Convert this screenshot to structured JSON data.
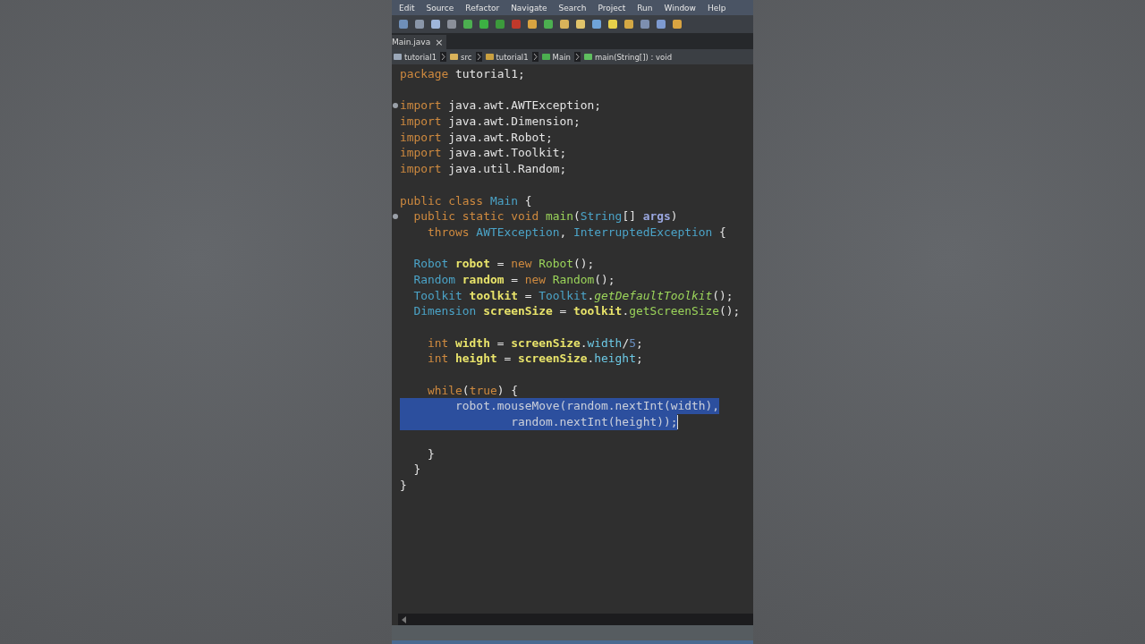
{
  "menu_bar": [
    "Edit",
    "Source",
    "Refactor",
    "Navigate",
    "Search",
    "Project",
    "Run",
    "Window",
    "Help"
  ],
  "editor_tab": {
    "label": "Main.java",
    "close": "×",
    "selected": true
  },
  "breadcrumb": [
    {
      "kind": "project",
      "label": "tutorial1"
    },
    {
      "kind": "folder",
      "label": "src"
    },
    {
      "kind": "package",
      "label": "tutorial1"
    },
    {
      "kind": "class",
      "label": "Main"
    },
    {
      "kind": "method",
      "label": "main(String[]) : void"
    }
  ],
  "code_lines": [
    {
      "selected": false,
      "tokens": [
        {
          "kind": "keyword",
          "text": "package"
        },
        {
          "kind": "plain",
          "text": " tutorial1;"
        }
      ]
    },
    {
      "selected": false
    },
    {
      "selected": false,
      "fold_marker": true,
      "tokens": [
        {
          "kind": "keyword",
          "text": "import"
        },
        {
          "kind": "plain",
          "text": " java.awt.AWTException;"
        }
      ]
    },
    {
      "selected": false,
      "tokens": [
        {
          "kind": "keyword",
          "text": "import"
        },
        {
          "kind": "plain",
          "text": " java.awt.Dimension;"
        }
      ]
    },
    {
      "selected": false,
      "tokens": [
        {
          "kind": "keyword",
          "text": "import"
        },
        {
          "kind": "plain",
          "text": " java.awt.Robot;"
        }
      ]
    },
    {
      "selected": false,
      "tokens": [
        {
          "kind": "keyword",
          "text": "import"
        },
        {
          "kind": "plain",
          "text": " java.awt.Toolkit;"
        }
      ]
    },
    {
      "selected": false,
      "tokens": [
        {
          "kind": "keyword",
          "text": "import"
        },
        {
          "kind": "plain",
          "text": " java.util.Random;"
        }
      ]
    },
    {
      "selected": false
    },
    {
      "selected": false,
      "tokens": [
        {
          "kind": "keyword",
          "text": "public class"
        },
        {
          "kind": "type",
          "text": " Main"
        },
        {
          "kind": "plain",
          "text": " {"
        }
      ]
    },
    {
      "selected": false,
      "fold_marker": true,
      "tokens": [
        {
          "kind": "keyword",
          "text": "  public static void"
        },
        {
          "kind": "method",
          "text": " main"
        },
        {
          "kind": "plain",
          "text": "("
        },
        {
          "kind": "type",
          "text": "String"
        },
        {
          "kind": "plain",
          "text": "[]"
        },
        {
          "kind": "param",
          "text": " args"
        },
        {
          "kind": "plain",
          "text": ")"
        }
      ]
    },
    {
      "selected": false,
      "tokens": [
        {
          "kind": "keyword",
          "text": "    throws"
        },
        {
          "kind": "type",
          "text": " AWTException"
        },
        {
          "kind": "plain",
          "text": ", "
        },
        {
          "kind": "type",
          "text": "InterruptedException"
        },
        {
          "kind": "plain",
          "text": " {"
        }
      ]
    },
    {
      "selected": false
    },
    {
      "selected": false,
      "tokens": [
        {
          "kind": "type",
          "text": "  Robot"
        },
        {
          "kind": "variable",
          "text": " robot"
        },
        {
          "kind": "plain",
          "text": " = "
        },
        {
          "kind": "keyword",
          "text": "new"
        },
        {
          "kind": "method",
          "text": " Robot"
        },
        {
          "kind": "plain",
          "text": "();"
        }
      ]
    },
    {
      "selected": false,
      "tokens": [
        {
          "kind": "type",
          "text": "  Random"
        },
        {
          "kind": "variable",
          "text": " random"
        },
        {
          "kind": "plain",
          "text": " = "
        },
        {
          "kind": "keyword",
          "text": "new"
        },
        {
          "kind": "method",
          "text": " Random"
        },
        {
          "kind": "plain",
          "text": "();"
        }
      ]
    },
    {
      "selected": false,
      "tokens": [
        {
          "kind": "type",
          "text": "  Toolkit"
        },
        {
          "kind": "variable",
          "text": " toolkit"
        },
        {
          "kind": "plain",
          "text": " = "
        },
        {
          "kind": "type",
          "text": "Toolkit"
        },
        {
          "kind": "plain",
          "text": "."
        },
        {
          "kind": "static_method",
          "text": "getDefaultToolkit"
        },
        {
          "kind": "plain",
          "text": "();"
        }
      ]
    },
    {
      "selected": false,
      "tokens": [
        {
          "kind": "type",
          "text": "  Dimension"
        },
        {
          "kind": "variable",
          "text": " screenSize"
        },
        {
          "kind": "plain",
          "text": " = "
        },
        {
          "kind": "variable",
          "text": "toolkit"
        },
        {
          "kind": "plain",
          "text": "."
        },
        {
          "kind": "method",
          "text": "getScreenSize"
        },
        {
          "kind": "plain",
          "text": "();"
        }
      ]
    },
    {
      "selected": false
    },
    {
      "selected": false,
      "tokens": [
        {
          "kind": "keyword",
          "text": "    int"
        },
        {
          "kind": "variable",
          "text": " width"
        },
        {
          "kind": "plain",
          "text": " = "
        },
        {
          "kind": "variable",
          "text": "screenSize"
        },
        {
          "kind": "plain",
          "text": "."
        },
        {
          "kind": "field",
          "text": "width"
        },
        {
          "kind": "plain",
          "text": "/"
        },
        {
          "kind": "number",
          "text": "5"
        },
        {
          "kind": "plain",
          "text": ";"
        }
      ]
    },
    {
      "selected": false,
      "tokens": [
        {
          "kind": "keyword",
          "text": "    int"
        },
        {
          "kind": "variable",
          "text": " height"
        },
        {
          "kind": "plain",
          "text": " = "
        },
        {
          "kind": "variable",
          "text": "screenSize"
        },
        {
          "kind": "plain",
          "text": "."
        },
        {
          "kind": "field",
          "text": "height"
        },
        {
          "kind": "plain",
          "text": ";"
        }
      ]
    },
    {
      "selected": false
    },
    {
      "selected": false,
      "tokens": [
        {
          "kind": "keyword",
          "text": "    while"
        },
        {
          "kind": "plain",
          "text": "("
        },
        {
          "kind": "keyword",
          "text": "true"
        },
        {
          "kind": "plain",
          "text": ") {"
        }
      ]
    },
    {
      "selected": true,
      "tokens": [
        {
          "kind": "plain",
          "text": "        robot.mouseMove(random.nextInt(width),"
        }
      ]
    },
    {
      "selected": true,
      "caret": true,
      "tokens": [
        {
          "kind": "plain",
          "text": "                random.nextInt(height));"
        }
      ]
    },
    {
      "selected": false
    },
    {
      "selected": false,
      "tokens": [
        {
          "kind": "plain",
          "text": "    }"
        }
      ]
    },
    {
      "selected": false,
      "tokens": [
        {
          "kind": "plain",
          "text": "  }"
        }
      ]
    },
    {
      "selected": false,
      "tokens": [
        {
          "kind": "plain",
          "text": "}"
        }
      ]
    }
  ]
}
